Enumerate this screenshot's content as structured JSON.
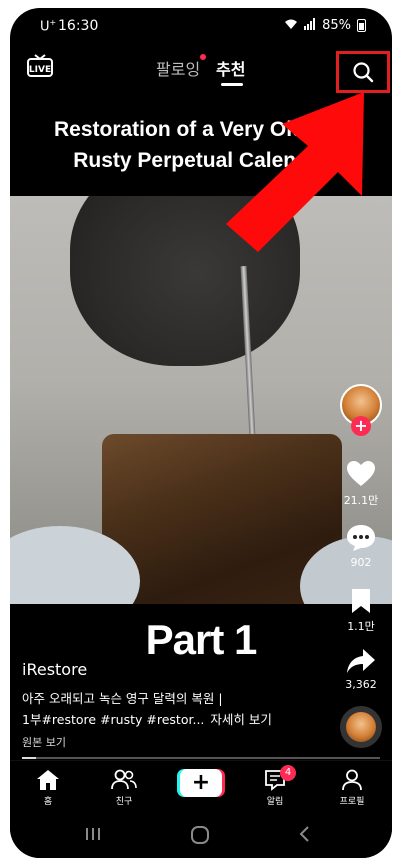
{
  "status_bar": {
    "carrier": "U",
    "carrier_sup": "+",
    "time": "16:30",
    "battery": "85%"
  },
  "top_nav": {
    "tab_following": "팔로잉",
    "tab_for_you": "추천"
  },
  "video": {
    "title_line1": "Restoration of a Very Old and",
    "title_line2": "Rusty Perpetual Calendar",
    "overlay_text": "Part 1",
    "progress": 0.04
  },
  "post": {
    "author": "iRestore",
    "caption_line1": "아주 오래되고 녹슨 영구 달력의 복원 |",
    "caption_line2": "1부#restore #rusty #restor...",
    "see_more": "자세히 보기",
    "original_sound": "원본 보기"
  },
  "rail": {
    "likes": "21.1만",
    "comments": "902",
    "saves": "1.1만",
    "shares": "3,362"
  },
  "tab_bar": {
    "home": "홈",
    "friends": "친구",
    "create": "+",
    "inbox": "알림",
    "inbox_badge": "4",
    "profile": "프로필"
  },
  "colors": {
    "accent_red": "#fe2c55",
    "accent_cyan": "#25f4ee",
    "annotation_red": "#e02020"
  },
  "icons": [
    "live-icon",
    "search-icon",
    "heart-icon",
    "comment-icon",
    "bookmark-icon",
    "share-icon",
    "home-icon",
    "friends-icon",
    "inbox-icon",
    "profile-icon"
  ]
}
